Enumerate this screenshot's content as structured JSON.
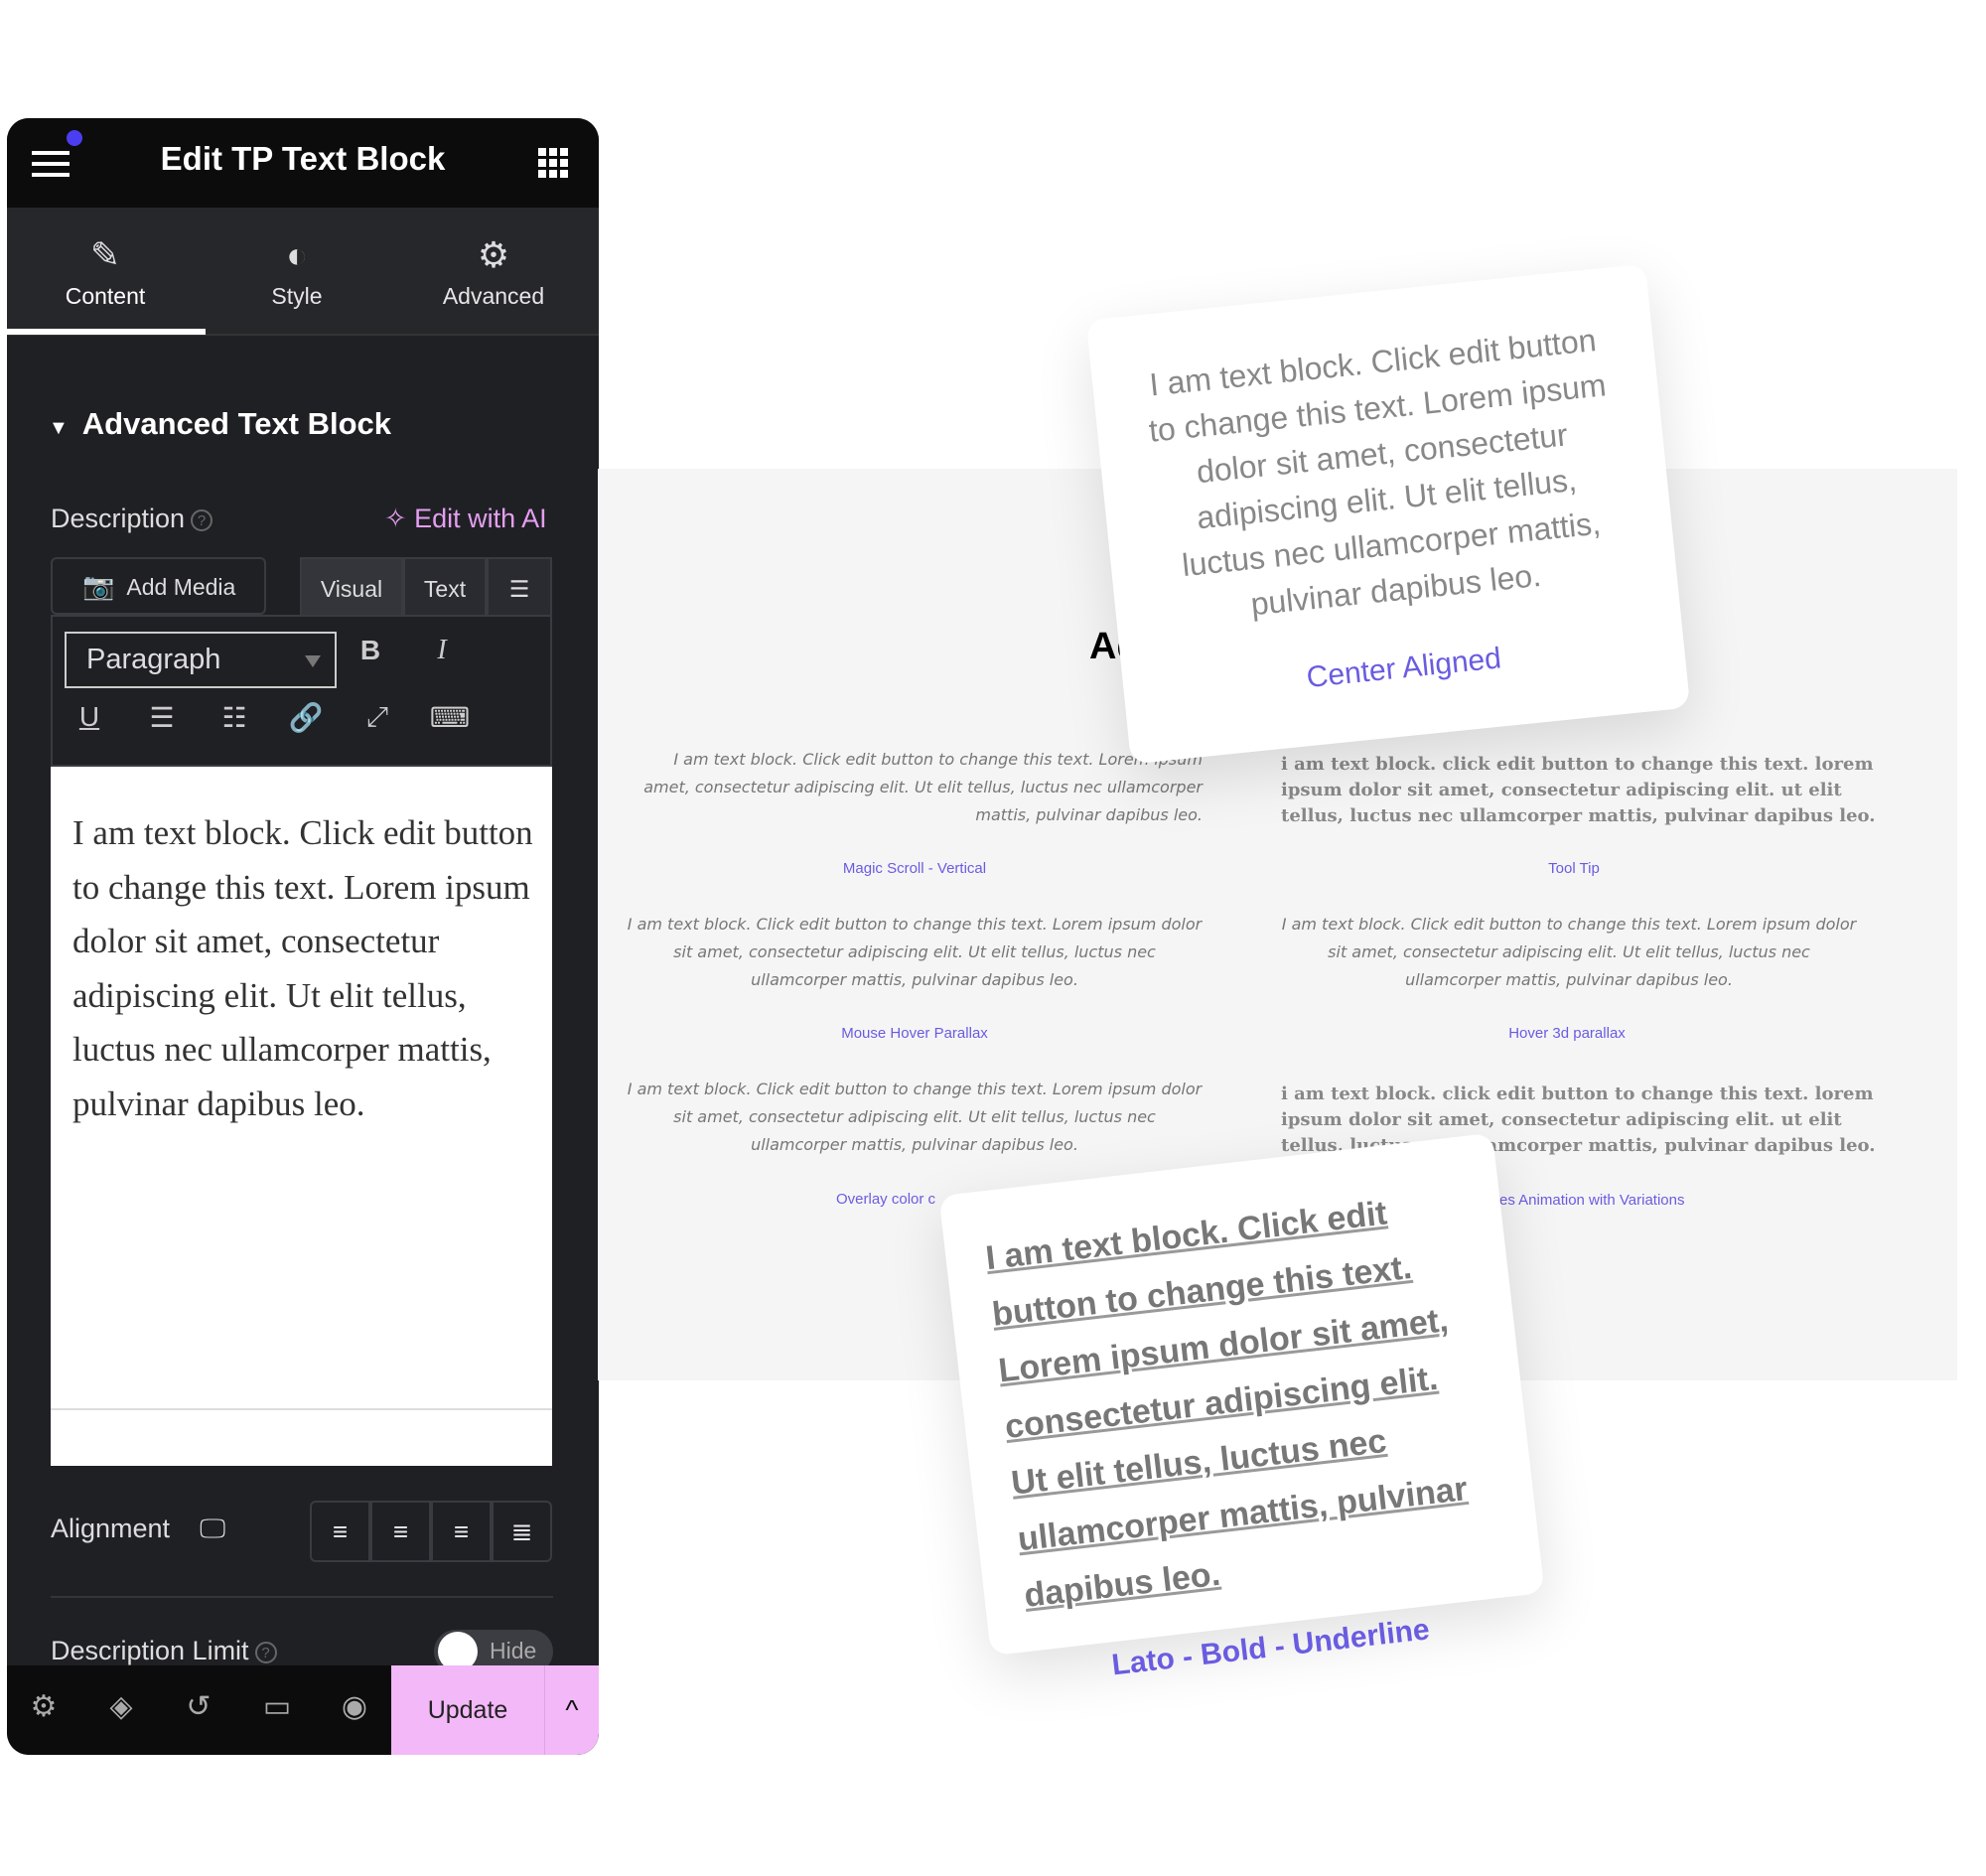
{
  "panel": {
    "title": "Edit TP Text Block",
    "tabs": [
      {
        "label": "Content",
        "icon": "pencil-icon"
      },
      {
        "label": "Style",
        "icon": "half-circle-icon"
      },
      {
        "label": "Advanced",
        "icon": "gear-icon"
      }
    ],
    "section_title": "Advanced Text Block",
    "description_label": "Description",
    "edit_ai": "Edit with AI",
    "add_media": "Add Media",
    "editor_tabs": [
      "Visual",
      "Text"
    ],
    "format_select": "Paragraph",
    "editor_text": "I am text block. Click edit button to change this text. Lorem ipsum dolor sit amet, consectetur adipiscing elit. Ut elit tellus, luctus nec ullamcorper mattis, pulvinar dapibus leo.",
    "alignment_label": "Alignment",
    "desc_limit_label": "Description Limit",
    "toggle_label": "Hide",
    "update": "Update",
    "accent": "#f3b8f8"
  },
  "preview": {
    "heading": "Ac",
    "lorem": "I am text block. Click edit button to change this text. Lorem ipsum dolor sit amet, consectetur adipiscing elit. Ut elit tellus, luctus nec ullamcorper mattis, pulvinar dapibus leo.",
    "lorem_first_clipped": "I am text block. Click edit button to change this text. Lorem ipsum",
    "lorem_first_rest": "amet, consectetur adipiscing elit. Ut elit tellus, luctus nec ullamcorper mattis, pulvinar dapibus leo.",
    "lorem_lower": "i am text block. click edit button to change this text. lorem ipsum dolor sit amet, consectetur adipiscing elit. ut elit tellus, luctus nec ullamcorper mattis, pulvinar dapibus leo.",
    "labels": [
      "Magic Scroll - Vertical",
      "Tool Tip",
      "Mouse Hover Parallax",
      "Hover 3d parallax",
      "Overlay color c",
      "es Animation with Variations"
    ],
    "card_top": {
      "text": "I am text block. Click edit button to change this text. Lorem ipsum dolor sit amet, consectetur adipiscing elit. Ut elit tellus, luctus nec ullamcorper mattis, pulvinar dapibus leo.",
      "label": "Center Aligned"
    },
    "card_bottom": {
      "text": "I am text block. Click edit button to change this text. Lorem ipsum dolor sit amet, consectetur adipiscing elit. Ut elit tellus, luctus nec ullamcorper mattis, pulvinar dapibus leo.",
      "label": "Lato - Bold - Underline"
    },
    "link_color": "#6a5ce0"
  }
}
